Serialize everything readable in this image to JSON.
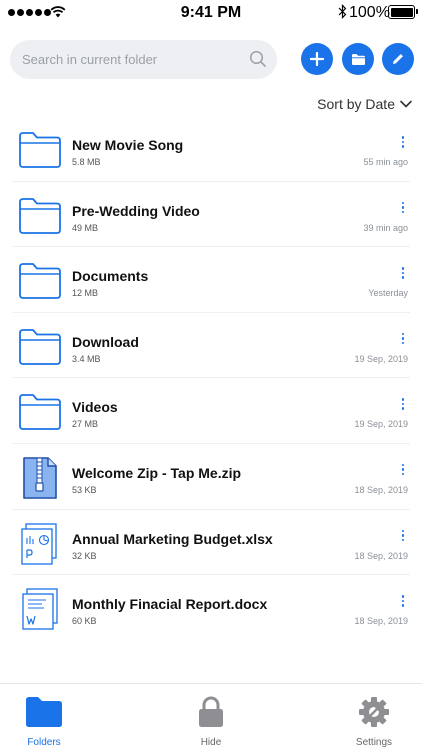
{
  "status_bar": {
    "time": "9:41 PM",
    "battery": "100%",
    "battery_level": 1.0
  },
  "search": {
    "placeholder": "Search in current folder",
    "value": ""
  },
  "actions": {
    "add_icon": "plus-icon",
    "new_folder_icon": "folder-icon",
    "edit_icon": "pencil-icon"
  },
  "sort": {
    "label": "Sort by Date"
  },
  "files": [
    {
      "type": "folder",
      "name": "New Movie Song",
      "size": "5.8 MB",
      "date": "55 min ago"
    },
    {
      "type": "folder",
      "name": "Pre-Wedding Video",
      "size": "49 MB",
      "date": "39 min ago"
    },
    {
      "type": "folder",
      "name": "Documents",
      "size": "12 MB",
      "date": "Yesterday"
    },
    {
      "type": "folder",
      "name": "Download",
      "size": "3.4 MB",
      "date": "19 Sep, 2019"
    },
    {
      "type": "folder",
      "name": "Videos",
      "size": "27 MB",
      "date": "19 Sep, 2019"
    },
    {
      "type": "zip",
      "name": "Welcome Zip - Tap Me.zip",
      "size": "53 KB",
      "date": "18 Sep, 2019"
    },
    {
      "type": "xlsx",
      "name": "Annual Marketing Budget.xlsx",
      "size": "32 KB",
      "date": "18 Sep, 2019"
    },
    {
      "type": "docx",
      "name": "Monthly Finacial Report.docx",
      "size": "60 KB",
      "date": "18 Sep, 2019"
    }
  ],
  "tabs": [
    {
      "label": "Folders",
      "icon": "folder-icon",
      "active": true
    },
    {
      "label": "Hide",
      "icon": "lock-icon",
      "active": false
    },
    {
      "label": "Settings",
      "icon": "gear-icon",
      "active": false
    }
  ],
  "colors": {
    "accent": "#1a73e8",
    "folder_stroke": "#1a73e8",
    "inactive_icon": "#8e8e93"
  }
}
